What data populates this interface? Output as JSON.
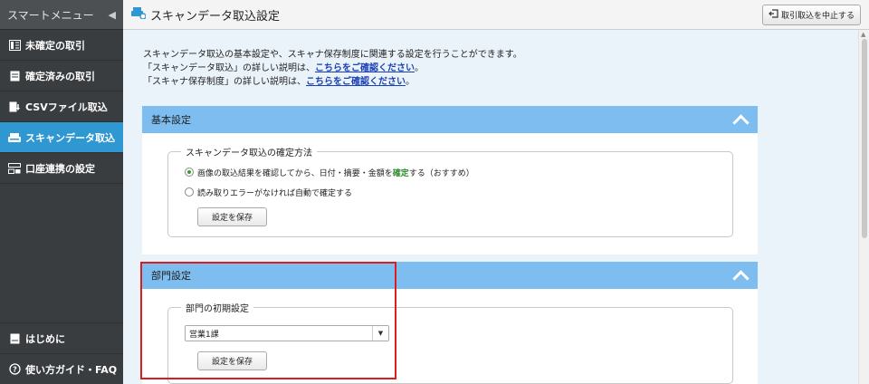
{
  "sidebar": {
    "title": "スマートメニュー",
    "items": [
      {
        "label": "未確定の取引",
        "icon": "unconfirmed-transactions-icon"
      },
      {
        "label": "確定済みの取引",
        "icon": "confirmed-transactions-icon"
      },
      {
        "label": "CSVファイル取込",
        "icon": "csv-import-icon"
      },
      {
        "label": "スキャンデータ取込",
        "icon": "scanner-icon"
      },
      {
        "label": "口座連携の設定",
        "icon": "account-link-icon"
      }
    ],
    "bottom_items": [
      {
        "label": "はじめに",
        "icon": "intro-icon"
      },
      {
        "label": "使い方ガイド・FAQ",
        "icon": "help-icon"
      }
    ]
  },
  "header": {
    "title": "スキャンデータ取込設定",
    "cancel_label": "取引取込を中止する"
  },
  "intro": {
    "line1": "スキャンデータ取込の基本設定や、スキャナ保存制度に関連する設定を行うことができます。",
    "line2_prefix": "「スキャンデータ取込」の詳しい説明は、",
    "line2_link": "こちらをご確認ください",
    "line2_suffix": "。",
    "line3_prefix": "「スキャナ保存制度」の詳しい説明は、",
    "line3_link": "こちらをご確認ください",
    "line3_suffix": "。"
  },
  "basic": {
    "title": "基本設定",
    "legend": "スキャンデータ取込の確定方法",
    "option1_prefix": "画像の取込結果を確認してから、日付・摘要・金額を",
    "option1_highlight": "確定",
    "option1_suffix": "する（おすすめ）",
    "option2": "読み取りエラーがなければ自動で確定する",
    "option1_selected": true,
    "save_label": "設定を保存"
  },
  "dept": {
    "title": "部門設定",
    "legend": "部門の初期設定",
    "selected": "営業1課",
    "save_label": "設定を保存"
  },
  "colors": {
    "accent": "#2f97d1",
    "section_header": "#7dbdf0",
    "highlight": "#d81e1e"
  }
}
